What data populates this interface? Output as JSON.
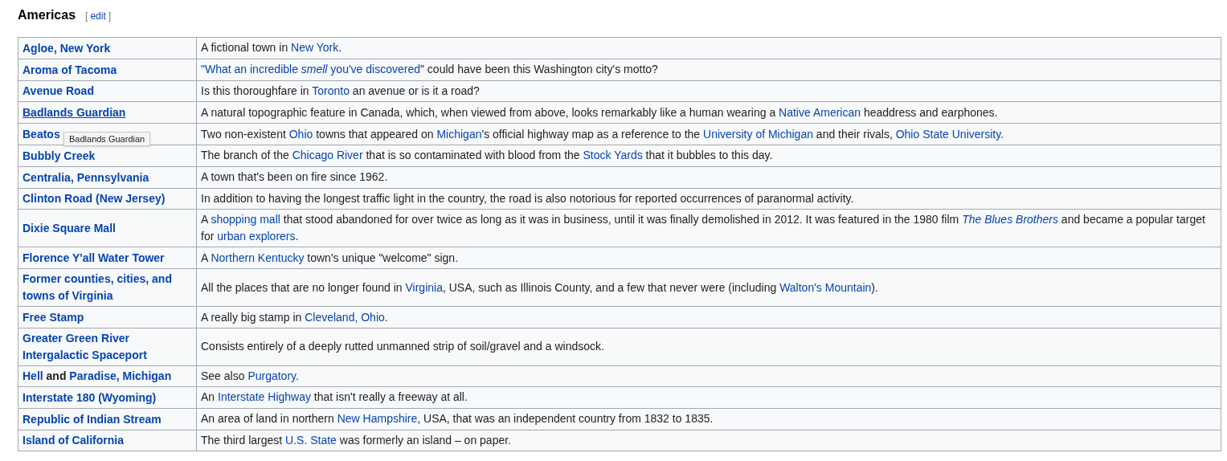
{
  "heading": {
    "title": "Americas",
    "edit": {
      "open": "[",
      "label": "edit",
      "close": "]"
    }
  },
  "rows": [
    {
      "name": [
        {
          "kind": "link",
          "text": "Agloe, New York"
        }
      ],
      "description": [
        {
          "kind": "text",
          "text": "A fictional town in "
        },
        {
          "kind": "link",
          "text": "New York"
        },
        {
          "kind": "text",
          "text": "."
        }
      ]
    },
    {
      "name": [
        {
          "kind": "link",
          "text": "Aroma of Tacoma"
        }
      ],
      "description": [
        {
          "kind": "link",
          "text": "\"What an incredible *smell* you've discovered"
        },
        {
          "kind": "text",
          "text": "\" could have been this Washington city's motto?"
        }
      ]
    },
    {
      "name": [
        {
          "kind": "link",
          "text": "Avenue Road"
        }
      ],
      "description": [
        {
          "kind": "text",
          "text": "Is this thoroughfare in "
        },
        {
          "kind": "link",
          "text": "Toronto"
        },
        {
          "kind": "text",
          "text": " an avenue or is it a road?"
        }
      ]
    },
    {
      "name": [
        {
          "kind": "link",
          "text": "Badlands Guardian",
          "hovered": true
        }
      ],
      "description": [
        {
          "kind": "text",
          "text": "A natural topographic feature in Canada, which, when viewed from above, looks remarkably like a human wearing a "
        },
        {
          "kind": "link",
          "text": "Native American"
        },
        {
          "kind": "text",
          "text": " headdress and earphones."
        }
      ]
    },
    {
      "name": [
        {
          "kind": "link",
          "text": "Beatos"
        }
      ],
      "tooltip": "Badlands Guardian",
      "description": [
        {
          "kind": "text",
          "text": "Two non-existent "
        },
        {
          "kind": "link",
          "text": "Ohio"
        },
        {
          "kind": "text",
          "text": " towns that appeared on "
        },
        {
          "kind": "link",
          "text": "Michigan"
        },
        {
          "kind": "text",
          "text": "'s official highway map as a reference to the "
        },
        {
          "kind": "link",
          "text": "University of Michigan"
        },
        {
          "kind": "text",
          "text": " and their rivals, "
        },
        {
          "kind": "link",
          "text": "Ohio State University"
        },
        {
          "kind": "text",
          "text": "."
        }
      ]
    },
    {
      "name": [
        {
          "kind": "link",
          "text": "Bubbly Creek"
        }
      ],
      "description": [
        {
          "kind": "text",
          "text": "The branch of the "
        },
        {
          "kind": "link",
          "text": "Chicago River"
        },
        {
          "kind": "text",
          "text": " that is so contaminated with blood from the "
        },
        {
          "kind": "link",
          "text": "Stock Yards"
        },
        {
          "kind": "text",
          "text": " that it bubbles to this day."
        }
      ]
    },
    {
      "name": [
        {
          "kind": "link",
          "text": "Centralia, Pennsylvania"
        }
      ],
      "description": [
        {
          "kind": "text",
          "text": "A town that's been on fire since 1962."
        }
      ]
    },
    {
      "name": [
        {
          "kind": "link",
          "text": "Clinton Road (New Jersey)"
        }
      ],
      "description": [
        {
          "kind": "text",
          "text": "In addition to having the longest traffic light in the country, the road is also notorious for reported occurrences of paranormal activity."
        }
      ]
    },
    {
      "name": [
        {
          "kind": "link",
          "text": "Dixie Square Mall"
        }
      ],
      "description": [
        {
          "kind": "text",
          "text": "A "
        },
        {
          "kind": "link",
          "text": "shopping mall"
        },
        {
          "kind": "text",
          "text": " that stood abandoned for over twice as long as it was in business, until it was finally demolished in 2012. It was featured in the 1980 film "
        },
        {
          "kind": "link",
          "text": "*The Blues Brothers*"
        },
        {
          "kind": "text",
          "text": " and became a popular target for "
        },
        {
          "kind": "link",
          "text": "urban explorers"
        },
        {
          "kind": "text",
          "text": "."
        }
      ]
    },
    {
      "name": [
        {
          "kind": "link",
          "text": "Florence Y'all Water Tower"
        }
      ],
      "description": [
        {
          "kind": "text",
          "text": "A "
        },
        {
          "kind": "link",
          "text": "Northern Kentucky"
        },
        {
          "kind": "text",
          "text": " town's unique \"welcome\" sign."
        }
      ]
    },
    {
      "name": [
        {
          "kind": "link",
          "text": "Former counties, cities, and towns of Virginia"
        }
      ],
      "description": [
        {
          "kind": "text",
          "text": "All the places that are no longer found in "
        },
        {
          "kind": "link",
          "text": "Virginia"
        },
        {
          "kind": "text",
          "text": ", USA, such as Illinois County, and a few that never were (including "
        },
        {
          "kind": "link",
          "text": "Walton's Mountain"
        },
        {
          "kind": "text",
          "text": ")."
        }
      ]
    },
    {
      "name": [
        {
          "kind": "link",
          "text": "Free Stamp"
        }
      ],
      "description": [
        {
          "kind": "text",
          "text": "A really big stamp in "
        },
        {
          "kind": "link",
          "text": "Cleveland, Ohio"
        },
        {
          "kind": "text",
          "text": "."
        }
      ]
    },
    {
      "name": [
        {
          "kind": "link",
          "text": "Greater Green River Intergalactic Spaceport"
        }
      ],
      "description": [
        {
          "kind": "text",
          "text": "Consists entirely of a deeply rutted unmanned strip of soil/gravel and a windsock."
        }
      ]
    },
    {
      "name": [
        {
          "kind": "link",
          "text": "Hell"
        },
        {
          "kind": "text",
          "text": " and "
        },
        {
          "kind": "link",
          "text": "Paradise, Michigan"
        }
      ],
      "description": [
        {
          "kind": "text",
          "text": "See also "
        },
        {
          "kind": "link",
          "text": "Purgatory"
        },
        {
          "kind": "text",
          "text": "."
        }
      ]
    },
    {
      "name": [
        {
          "kind": "link",
          "text": "Interstate 180 (Wyoming)"
        }
      ],
      "description": [
        {
          "kind": "text",
          "text": "An "
        },
        {
          "kind": "link",
          "text": "Interstate Highway"
        },
        {
          "kind": "text",
          "text": " that isn't really a freeway at all."
        }
      ]
    },
    {
      "name": [
        {
          "kind": "link",
          "text": "Republic of Indian Stream"
        }
      ],
      "description": [
        {
          "kind": "text",
          "text": "An area of land in northern "
        },
        {
          "kind": "link",
          "text": "New Hampshire"
        },
        {
          "kind": "text",
          "text": ", USA, that was an independent country from 1832 to 1835."
        }
      ]
    },
    {
      "name": [
        {
          "kind": "link",
          "text": "Island of California"
        }
      ],
      "description": [
        {
          "kind": "text",
          "text": "The third largest "
        },
        {
          "kind": "link",
          "text": "U.S. State"
        },
        {
          "kind": "text",
          "text": " was formerly an island – on paper."
        }
      ]
    }
  ]
}
